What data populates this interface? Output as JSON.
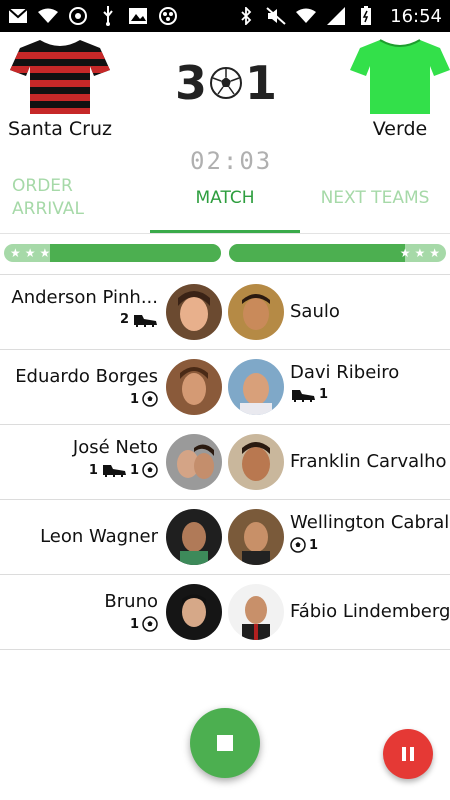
{
  "statusbar": {
    "time": "16:54",
    "left_icons": [
      "mail-icon",
      "wifi-icon",
      "whatsapp-icon",
      "usb-icon",
      "gallery-icon",
      "app-icon"
    ],
    "right_icons": [
      "bluetooth-icon",
      "mute-icon",
      "wifi-icon",
      "signal-icon",
      "battery-icon"
    ]
  },
  "match": {
    "home": {
      "name": "Santa Cruz",
      "shirt_colors": [
        "#c62828",
        "#111111"
      ]
    },
    "away": {
      "name": "Verde",
      "shirt_color": "#33e04a"
    },
    "home_score": "3",
    "away_score": "1",
    "timer": "02:03"
  },
  "tabs": [
    {
      "label": "ORDER\nARRIVAL"
    },
    {
      "label": "MATCH"
    },
    {
      "label": "NEXT TEAMS"
    }
  ],
  "ratings": {
    "left": {
      "stars": 3,
      "fill_fraction": 0.79
    },
    "right": {
      "stars": 3,
      "fill_fraction": 0.81
    }
  },
  "rows": [
    {
      "left": {
        "name": "Anderson Pinh...",
        "stats": [
          {
            "count": "2",
            "icon": "boot-icon"
          }
        ]
      },
      "right": {
        "name": "Saulo",
        "stats": []
      }
    },
    {
      "left": {
        "name": "Eduardo Borges",
        "stats": [
          {
            "count": "1",
            "icon": "ball-icon"
          }
        ]
      },
      "right": {
        "name": "Davi Ribeiro",
        "stats": [
          {
            "count": "1",
            "icon": "boot-icon"
          }
        ]
      }
    },
    {
      "left": {
        "name": "José Neto",
        "stats": [
          {
            "count": "1",
            "icon": "boot-icon"
          },
          {
            "count": "1",
            "icon": "ball-icon"
          }
        ]
      },
      "right": {
        "name": "Franklin Carvalho",
        "stats": []
      }
    },
    {
      "left": {
        "name": "Leon Wagner",
        "stats": []
      },
      "right": {
        "name": "Wellington Cabral",
        "stats": [
          {
            "count": "1",
            "icon": "ball-icon"
          }
        ]
      }
    },
    {
      "left": {
        "name": "Bruno",
        "stats": [
          {
            "count": "1",
            "icon": "ball-icon"
          }
        ]
      },
      "right": {
        "name": "Fábio Lindemberg",
        "stats": []
      }
    }
  ],
  "colors": {
    "accent": "#4caf50",
    "accent_light": "#a6d9a8",
    "pause": "#e53935"
  }
}
